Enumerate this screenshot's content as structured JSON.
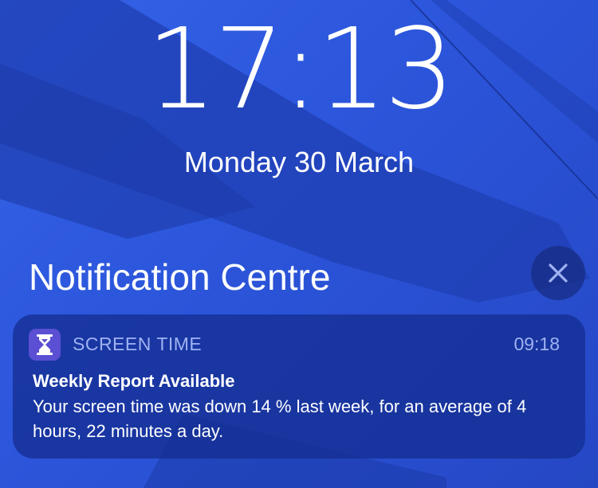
{
  "lock_screen": {
    "time": "17:13",
    "date": "Monday 30 March"
  },
  "notification_centre": {
    "title": "Notification Centre",
    "close_icon": "close-icon"
  },
  "notification": {
    "app_icon": "hourglass-icon",
    "app_name": "SCREEN TIME",
    "time": "09:18",
    "title": "Weekly Report Available",
    "body": "Your screen time was down 14 % last week, for an average of 4 hours, 22 minutes a day."
  },
  "colors": {
    "wallpaper": "#2b52d6",
    "card": "#152e92",
    "app_icon": "#5b4fd3",
    "secondary_text": "#9fb2f2"
  }
}
